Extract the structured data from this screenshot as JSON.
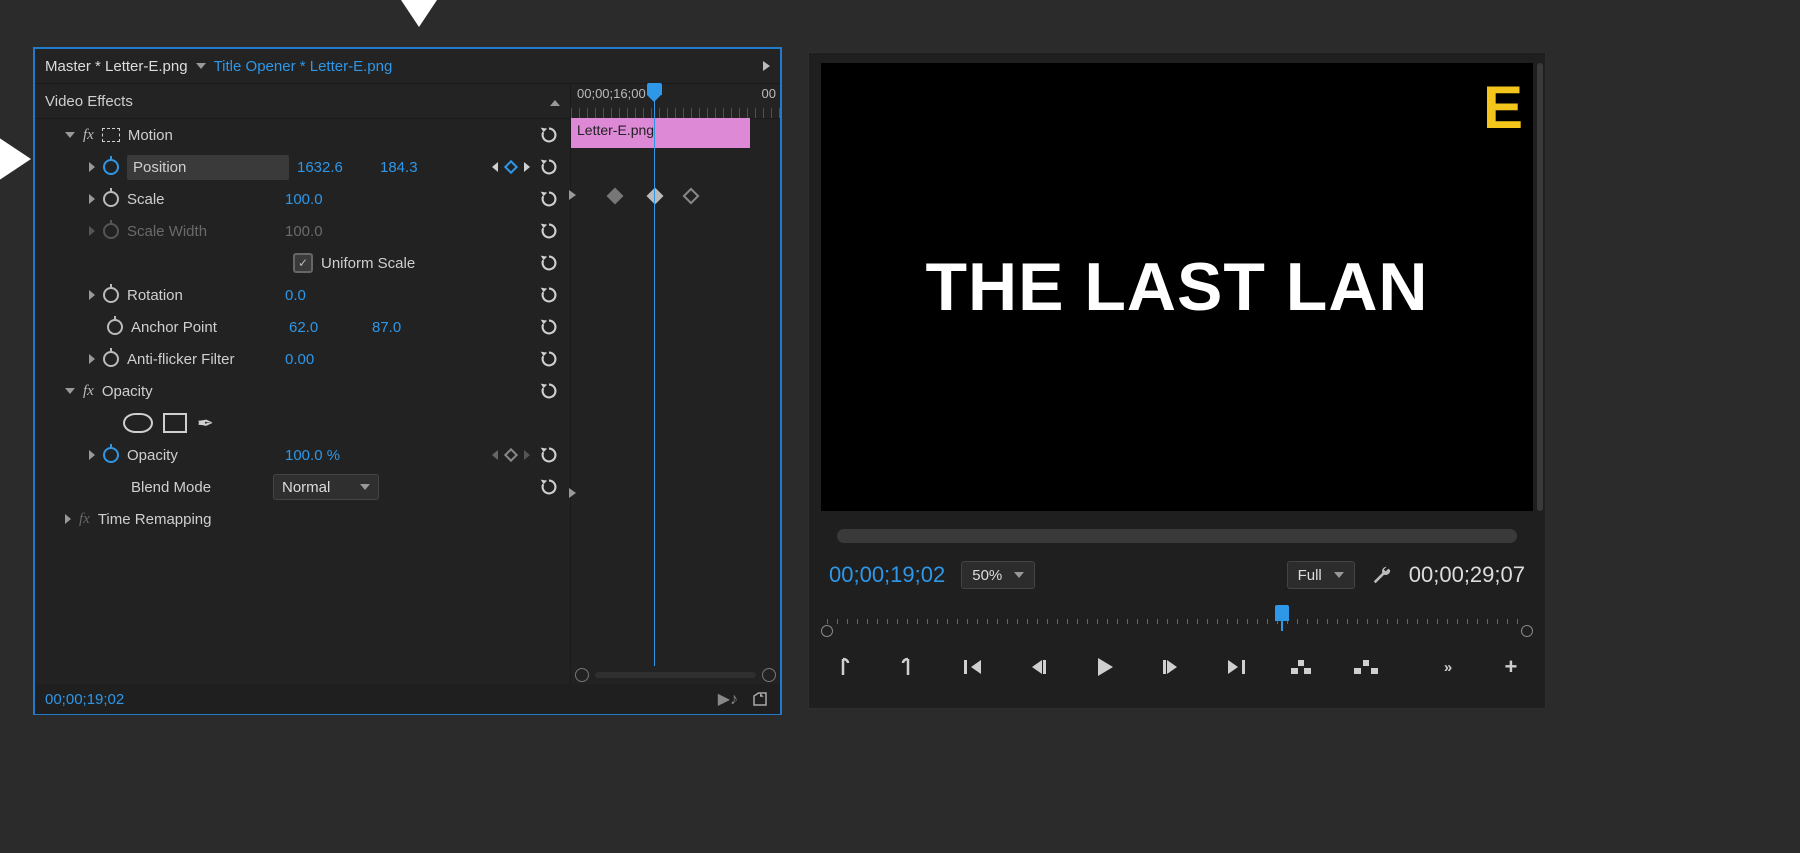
{
  "effectControls": {
    "crumbMaster": "Master * Letter-E.png",
    "crumbSequence": "Title Opener * Letter-E.png",
    "sectionLabel": "Video Effects",
    "motionLabel": "Motion",
    "position": {
      "label": "Position",
      "x": "1632.6",
      "y": "184.3"
    },
    "scale": {
      "label": "Scale",
      "value": "100.0"
    },
    "scaleWidth": {
      "label": "Scale Width",
      "value": "100.0"
    },
    "uniformScaleLabel": "Uniform Scale",
    "rotation": {
      "label": "Rotation",
      "value": "0.0"
    },
    "anchorPoint": {
      "label": "Anchor Point",
      "x": "62.0",
      "y": "87.0"
    },
    "antiFlicker": {
      "label": "Anti-flicker Filter",
      "value": "0.00"
    },
    "opacitySection": "Opacity",
    "opacity": {
      "label": "Opacity",
      "value": "100.0 %"
    },
    "blendMode": {
      "label": "Blend Mode",
      "value": "Normal"
    },
    "timeRemapping": "Time Remapping",
    "footerTime": "00;00;19;02",
    "miniClip": "Letter-E.png",
    "rulerLabel1": "00;00;16;00",
    "rulerLabel2": "00"
  },
  "monitor": {
    "titleText": "THE LAST LAN",
    "floatingLetter": "E",
    "timecodeIn": "00;00;19;02",
    "zoom": "50%",
    "resolution": "Full",
    "timecodeOut": "00;00;29;07"
  }
}
